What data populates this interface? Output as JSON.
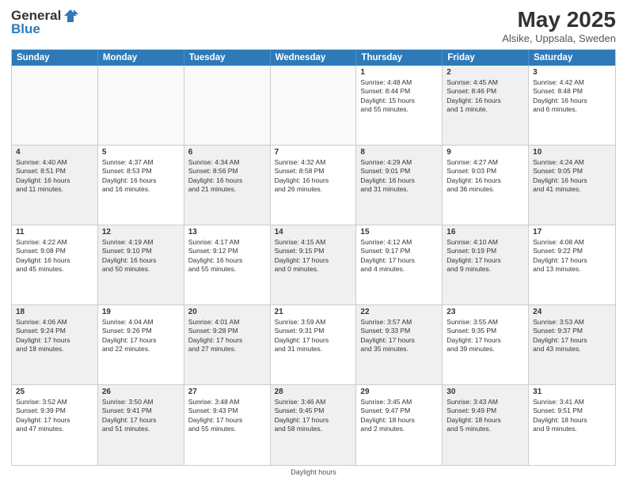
{
  "header": {
    "logo_general": "General",
    "logo_blue": "Blue",
    "month_year": "May 2025",
    "location": "Alsike, Uppsala, Sweden"
  },
  "days_of_week": [
    "Sunday",
    "Monday",
    "Tuesday",
    "Wednesday",
    "Thursday",
    "Friday",
    "Saturday"
  ],
  "weeks": [
    [
      {
        "day": "",
        "lines": [],
        "empty": true
      },
      {
        "day": "",
        "lines": [],
        "empty": true
      },
      {
        "day": "",
        "lines": [],
        "empty": true
      },
      {
        "day": "",
        "lines": [],
        "empty": true
      },
      {
        "day": "1",
        "lines": [
          "Sunrise: 4:48 AM",
          "Sunset: 8:44 PM",
          "Daylight: 15 hours",
          "and 55 minutes."
        ]
      },
      {
        "day": "2",
        "lines": [
          "Sunrise: 4:45 AM",
          "Sunset: 8:46 PM",
          "Daylight: 16 hours",
          "and 1 minute."
        ],
        "shaded": true
      },
      {
        "day": "3",
        "lines": [
          "Sunrise: 4:42 AM",
          "Sunset: 8:48 PM",
          "Daylight: 16 hours",
          "and 6 minutes."
        ]
      }
    ],
    [
      {
        "day": "4",
        "lines": [
          "Sunrise: 4:40 AM",
          "Sunset: 8:51 PM",
          "Daylight: 16 hours",
          "and 11 minutes."
        ],
        "shaded": true
      },
      {
        "day": "5",
        "lines": [
          "Sunrise: 4:37 AM",
          "Sunset: 8:53 PM",
          "Daylight: 16 hours",
          "and 16 minutes."
        ]
      },
      {
        "day": "6",
        "lines": [
          "Sunrise: 4:34 AM",
          "Sunset: 8:56 PM",
          "Daylight: 16 hours",
          "and 21 minutes."
        ],
        "shaded": true
      },
      {
        "day": "7",
        "lines": [
          "Sunrise: 4:32 AM",
          "Sunset: 8:58 PM",
          "Daylight: 16 hours",
          "and 26 minutes."
        ]
      },
      {
        "day": "8",
        "lines": [
          "Sunrise: 4:29 AM",
          "Sunset: 9:01 PM",
          "Daylight: 16 hours",
          "and 31 minutes."
        ],
        "shaded": true
      },
      {
        "day": "9",
        "lines": [
          "Sunrise: 4:27 AM",
          "Sunset: 9:03 PM",
          "Daylight: 16 hours",
          "and 36 minutes."
        ]
      },
      {
        "day": "10",
        "lines": [
          "Sunrise: 4:24 AM",
          "Sunset: 9:05 PM",
          "Daylight: 16 hours",
          "and 41 minutes."
        ],
        "shaded": true
      }
    ],
    [
      {
        "day": "11",
        "lines": [
          "Sunrise: 4:22 AM",
          "Sunset: 9:08 PM",
          "Daylight: 16 hours",
          "and 45 minutes."
        ]
      },
      {
        "day": "12",
        "lines": [
          "Sunrise: 4:19 AM",
          "Sunset: 9:10 PM",
          "Daylight: 16 hours",
          "and 50 minutes."
        ],
        "shaded": true
      },
      {
        "day": "13",
        "lines": [
          "Sunrise: 4:17 AM",
          "Sunset: 9:12 PM",
          "Daylight: 16 hours",
          "and 55 minutes."
        ]
      },
      {
        "day": "14",
        "lines": [
          "Sunrise: 4:15 AM",
          "Sunset: 9:15 PM",
          "Daylight: 17 hours",
          "and 0 minutes."
        ],
        "shaded": true
      },
      {
        "day": "15",
        "lines": [
          "Sunrise: 4:12 AM",
          "Sunset: 9:17 PM",
          "Daylight: 17 hours",
          "and 4 minutes."
        ]
      },
      {
        "day": "16",
        "lines": [
          "Sunrise: 4:10 AM",
          "Sunset: 9:19 PM",
          "Daylight: 17 hours",
          "and 9 minutes."
        ],
        "shaded": true
      },
      {
        "day": "17",
        "lines": [
          "Sunrise: 4:08 AM",
          "Sunset: 9:22 PM",
          "Daylight: 17 hours",
          "and 13 minutes."
        ]
      }
    ],
    [
      {
        "day": "18",
        "lines": [
          "Sunrise: 4:06 AM",
          "Sunset: 9:24 PM",
          "Daylight: 17 hours",
          "and 18 minutes."
        ],
        "shaded": true
      },
      {
        "day": "19",
        "lines": [
          "Sunrise: 4:04 AM",
          "Sunset: 9:26 PM",
          "Daylight: 17 hours",
          "and 22 minutes."
        ]
      },
      {
        "day": "20",
        "lines": [
          "Sunrise: 4:01 AM",
          "Sunset: 9:28 PM",
          "Daylight: 17 hours",
          "and 27 minutes."
        ],
        "shaded": true
      },
      {
        "day": "21",
        "lines": [
          "Sunrise: 3:59 AM",
          "Sunset: 9:31 PM",
          "Daylight: 17 hours",
          "and 31 minutes."
        ]
      },
      {
        "day": "22",
        "lines": [
          "Sunrise: 3:57 AM",
          "Sunset: 9:33 PM",
          "Daylight: 17 hours",
          "and 35 minutes."
        ],
        "shaded": true
      },
      {
        "day": "23",
        "lines": [
          "Sunrise: 3:55 AM",
          "Sunset: 9:35 PM",
          "Daylight: 17 hours",
          "and 39 minutes."
        ]
      },
      {
        "day": "24",
        "lines": [
          "Sunrise: 3:53 AM",
          "Sunset: 9:37 PM",
          "Daylight: 17 hours",
          "and 43 minutes."
        ],
        "shaded": true
      }
    ],
    [
      {
        "day": "25",
        "lines": [
          "Sunrise: 3:52 AM",
          "Sunset: 9:39 PM",
          "Daylight: 17 hours",
          "and 47 minutes."
        ]
      },
      {
        "day": "26",
        "lines": [
          "Sunrise: 3:50 AM",
          "Sunset: 9:41 PM",
          "Daylight: 17 hours",
          "and 51 minutes."
        ],
        "shaded": true
      },
      {
        "day": "27",
        "lines": [
          "Sunrise: 3:48 AM",
          "Sunset: 9:43 PM",
          "Daylight: 17 hours",
          "and 55 minutes."
        ]
      },
      {
        "day": "28",
        "lines": [
          "Sunrise: 3:46 AM",
          "Sunset: 9:45 PM",
          "Daylight: 17 hours",
          "and 58 minutes."
        ],
        "shaded": true
      },
      {
        "day": "29",
        "lines": [
          "Sunrise: 3:45 AM",
          "Sunset: 9:47 PM",
          "Daylight: 18 hours",
          "and 2 minutes."
        ]
      },
      {
        "day": "30",
        "lines": [
          "Sunrise: 3:43 AM",
          "Sunset: 9:49 PM",
          "Daylight: 18 hours",
          "and 5 minutes."
        ],
        "shaded": true
      },
      {
        "day": "31",
        "lines": [
          "Sunrise: 3:41 AM",
          "Sunset: 9:51 PM",
          "Daylight: 18 hours",
          "and 9 minutes."
        ]
      }
    ]
  ],
  "footer": "Daylight hours"
}
